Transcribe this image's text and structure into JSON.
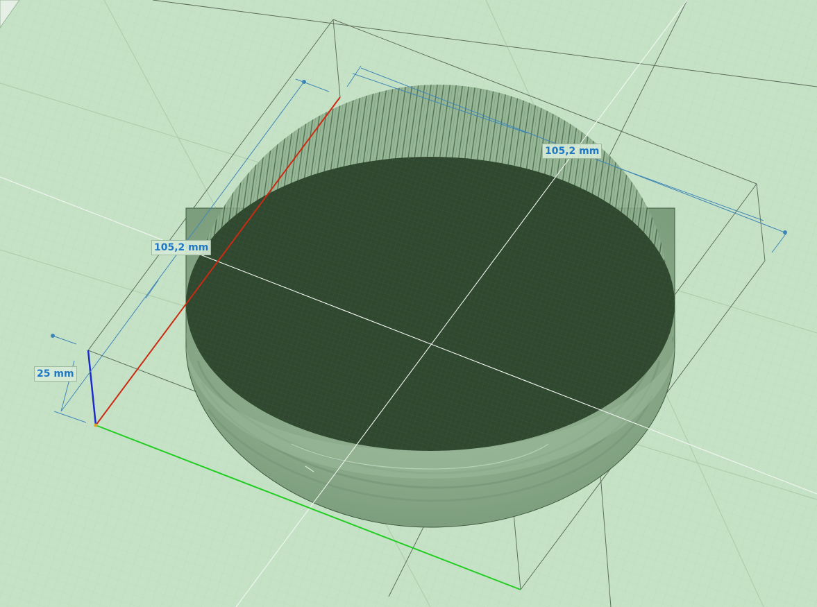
{
  "viewport": {
    "name": "3D model viewport",
    "background_color": "#c6e2c6"
  },
  "model": {
    "type": "screw cap",
    "surface_color": "#304a30",
    "knurl_color": "#3f5f3f"
  },
  "axes": {
    "x_color": "#22cc22",
    "y_color": "#cc2a10",
    "z_color": "#1b2ccc"
  },
  "dimensions": {
    "width_label": "105,2 mm",
    "depth_label": "105,2 mm",
    "height_label": "25 mm",
    "color": "#1f78c4"
  }
}
